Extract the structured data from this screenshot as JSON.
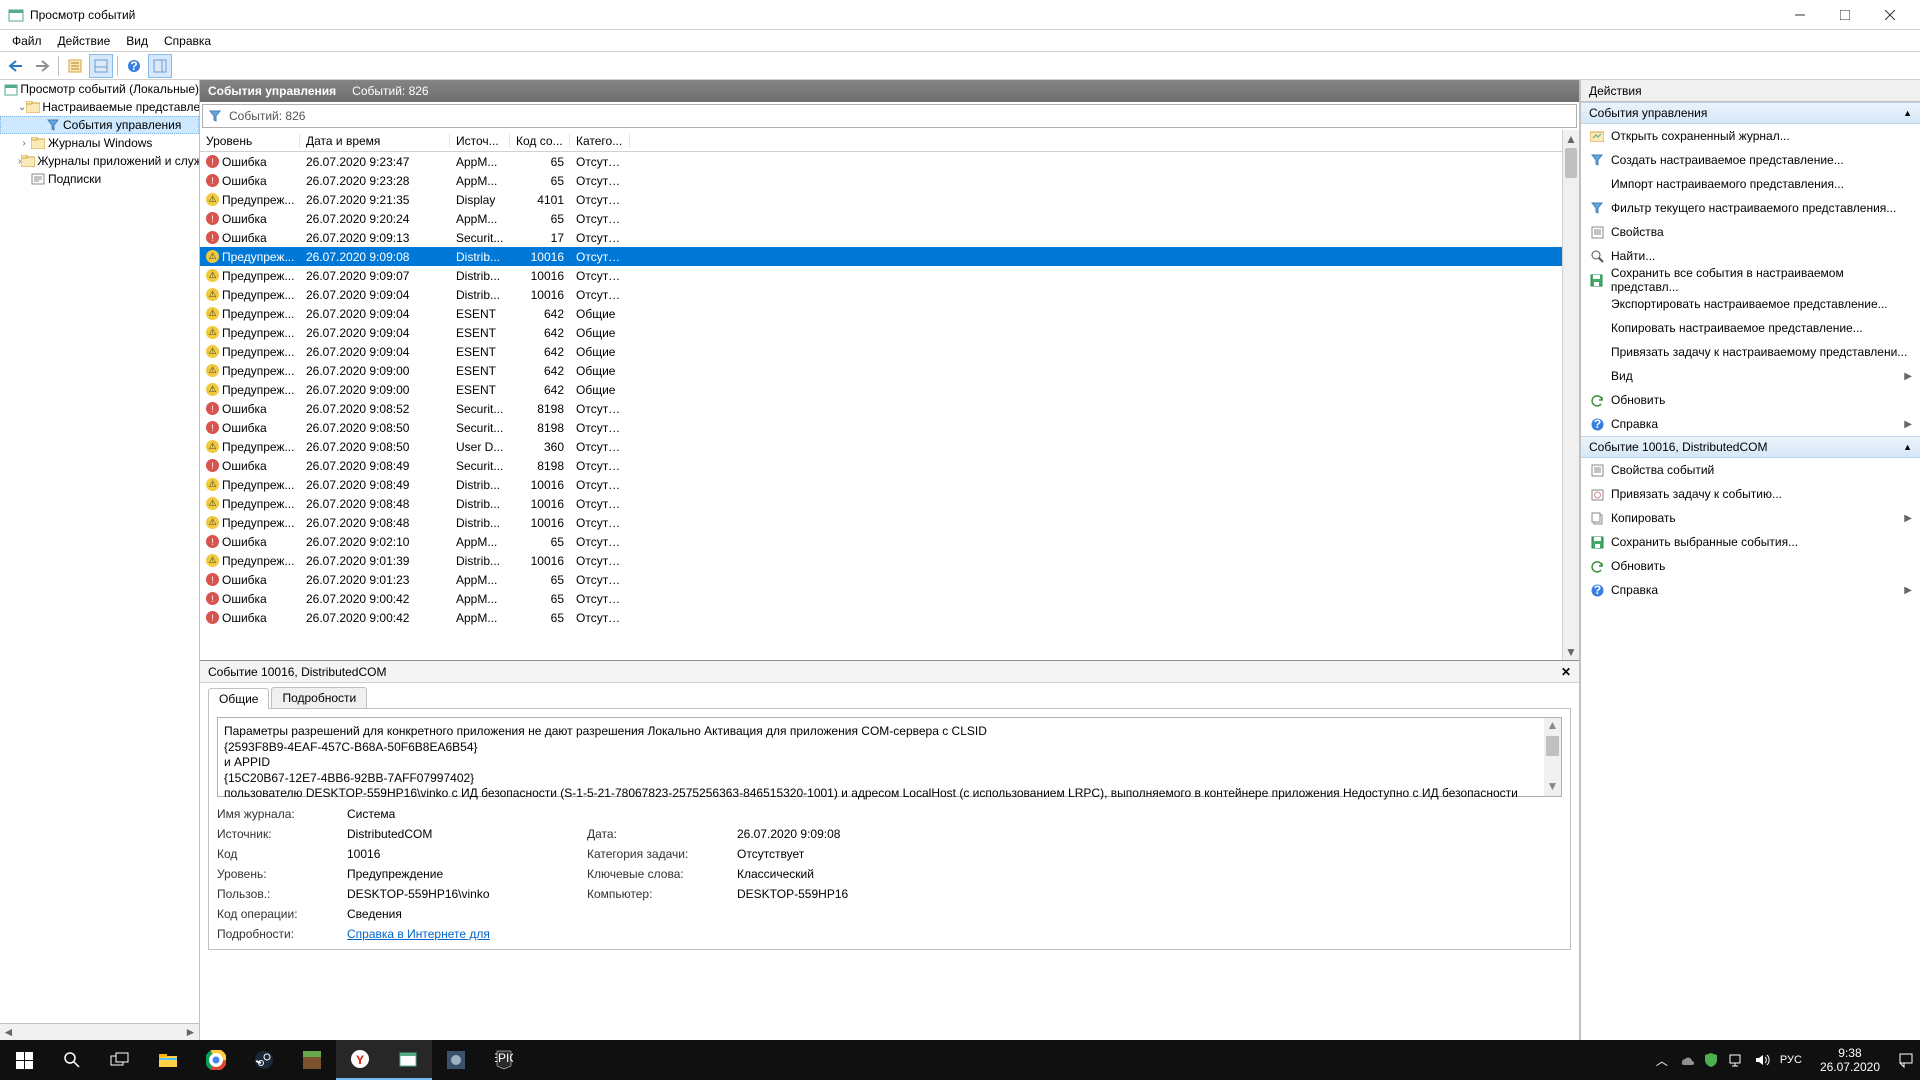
{
  "window": {
    "title": "Просмотр событий"
  },
  "menu": [
    "Файл",
    "Действие",
    "Вид",
    "Справка"
  ],
  "tree": {
    "root": "Просмотр событий (Локальные)",
    "items": [
      {
        "label": "Настраиваемые представления",
        "indent": 1,
        "twist": "v",
        "icon": "folder"
      },
      {
        "label": "События управления",
        "indent": 2,
        "twist": "",
        "icon": "filter",
        "selected": true
      },
      {
        "label": "Журналы Windows",
        "indent": 1,
        "twist": ">",
        "icon": "folder"
      },
      {
        "label": "Журналы приложений и служб",
        "indent": 1,
        "twist": ">",
        "icon": "folder"
      },
      {
        "label": "Подписки",
        "indent": 1,
        "twist": "",
        "icon": "sub"
      }
    ]
  },
  "center": {
    "title": "События управления",
    "count_label": "Событий: 826",
    "filter_label": "Событий: 826"
  },
  "cols": {
    "level": "Уровень",
    "datetime": "Дата и время",
    "source": "Источ...",
    "eventid": "Код со...",
    "category": "Катего..."
  },
  "rows": [
    {
      "lv": "err",
      "lvl": "Ошибка",
      "dt": "26.07.2020 9:23:47",
      "src": "AppM...",
      "id": "65",
      "cat": "Отсутс..."
    },
    {
      "lv": "err",
      "lvl": "Ошибка",
      "dt": "26.07.2020 9:23:28",
      "src": "AppM...",
      "id": "65",
      "cat": "Отсутс..."
    },
    {
      "lv": "warn",
      "lvl": "Предупреж...",
      "dt": "26.07.2020 9:21:35",
      "src": "Display",
      "id": "4101",
      "cat": "Отсутс..."
    },
    {
      "lv": "err",
      "lvl": "Ошибка",
      "dt": "26.07.2020 9:20:24",
      "src": "AppM...",
      "id": "65",
      "cat": "Отсутс..."
    },
    {
      "lv": "err",
      "lvl": "Ошибка",
      "dt": "26.07.2020 9:09:13",
      "src": "Securit...",
      "id": "17",
      "cat": "Отсутс..."
    },
    {
      "lv": "warn",
      "lvl": "Предупреж...",
      "dt": "26.07.2020 9:09:08",
      "src": "Distrib...",
      "id": "10016",
      "cat": "Отсутс...",
      "sel": true
    },
    {
      "lv": "warn",
      "lvl": "Предупреж...",
      "dt": "26.07.2020 9:09:07",
      "src": "Distrib...",
      "id": "10016",
      "cat": "Отсутс..."
    },
    {
      "lv": "warn",
      "lvl": "Предупреж...",
      "dt": "26.07.2020 9:09:04",
      "src": "Distrib...",
      "id": "10016",
      "cat": "Отсутс..."
    },
    {
      "lv": "warn",
      "lvl": "Предупреж...",
      "dt": "26.07.2020 9:09:04",
      "src": "ESENT",
      "id": "642",
      "cat": "Общие"
    },
    {
      "lv": "warn",
      "lvl": "Предупреж...",
      "dt": "26.07.2020 9:09:04",
      "src": "ESENT",
      "id": "642",
      "cat": "Общие"
    },
    {
      "lv": "warn",
      "lvl": "Предупреж...",
      "dt": "26.07.2020 9:09:04",
      "src": "ESENT",
      "id": "642",
      "cat": "Общие"
    },
    {
      "lv": "warn",
      "lvl": "Предупреж...",
      "dt": "26.07.2020 9:09:00",
      "src": "ESENT",
      "id": "642",
      "cat": "Общие"
    },
    {
      "lv": "warn",
      "lvl": "Предупреж...",
      "dt": "26.07.2020 9:09:00",
      "src": "ESENT",
      "id": "642",
      "cat": "Общие"
    },
    {
      "lv": "err",
      "lvl": "Ошибка",
      "dt": "26.07.2020 9:08:52",
      "src": "Securit...",
      "id": "8198",
      "cat": "Отсутс..."
    },
    {
      "lv": "err",
      "lvl": "Ошибка",
      "dt": "26.07.2020 9:08:50",
      "src": "Securit...",
      "id": "8198",
      "cat": "Отсутс..."
    },
    {
      "lv": "warn",
      "lvl": "Предупреж...",
      "dt": "26.07.2020 9:08:50",
      "src": "User D...",
      "id": "360",
      "cat": "Отсутс..."
    },
    {
      "lv": "err",
      "lvl": "Ошибка",
      "dt": "26.07.2020 9:08:49",
      "src": "Securit...",
      "id": "8198",
      "cat": "Отсутс..."
    },
    {
      "lv": "warn",
      "lvl": "Предупреж...",
      "dt": "26.07.2020 9:08:49",
      "src": "Distrib...",
      "id": "10016",
      "cat": "Отсутс..."
    },
    {
      "lv": "warn",
      "lvl": "Предупреж...",
      "dt": "26.07.2020 9:08:48",
      "src": "Distrib...",
      "id": "10016",
      "cat": "Отсутс..."
    },
    {
      "lv": "warn",
      "lvl": "Предупреж...",
      "dt": "26.07.2020 9:08:48",
      "src": "Distrib...",
      "id": "10016",
      "cat": "Отсутс..."
    },
    {
      "lv": "err",
      "lvl": "Ошибка",
      "dt": "26.07.2020 9:02:10",
      "src": "AppM...",
      "id": "65",
      "cat": "Отсутс..."
    },
    {
      "lv": "warn",
      "lvl": "Предупреж...",
      "dt": "26.07.2020 9:01:39",
      "src": "Distrib...",
      "id": "10016",
      "cat": "Отсутс..."
    },
    {
      "lv": "err",
      "lvl": "Ошибка",
      "dt": "26.07.2020 9:01:23",
      "src": "AppM...",
      "id": "65",
      "cat": "Отсутс..."
    },
    {
      "lv": "err",
      "lvl": "Ошибка",
      "dt": "26.07.2020 9:00:42",
      "src": "AppM...",
      "id": "65",
      "cat": "Отсутс..."
    },
    {
      "lv": "err",
      "lvl": "Ошибка",
      "dt": "26.07.2020 9:00:42",
      "src": "AppM...",
      "id": "65",
      "cat": "Отсутс..."
    }
  ],
  "detail": {
    "title": "Событие 10016, DistributedCOM",
    "tabs": [
      "Общие",
      "Подробности"
    ],
    "msg": [
      "Параметры разрешений для конкретного приложения не дают разрешения Локально Активация для приложения COM-сервера с CLSID",
      "{2593F8B9-4EAF-457C-B68A-50F6B8EA6B54}",
      " и APPID",
      "{15C20B67-12E7-4BB6-92BB-7AFF07997402}",
      " пользователю DESKTOP-559HP16\\vinko с ИД безопасности (S-1-5-21-78067823-2575256363-846515320-1001) и адресом LocalHost (с использованием LRPC), выполняемого в контейнере приложения Недоступно с ИД безопасности"
    ],
    "props": {
      "log_l": "Имя журнала:",
      "log_v": "Система",
      "src_l": "Источник:",
      "src_v": "DistributedCOM",
      "date_l": "Дата:",
      "date_v": "26.07.2020 9:09:08",
      "id_l": "Код",
      "id_v": "10016",
      "cat_l": "Категория задачи:",
      "cat_v": "Отсутствует",
      "lvl_l": "Уровень:",
      "lvl_v": "Предупреждение",
      "kw_l": "Ключевые слова:",
      "kw_v": "Классический",
      "usr_l": "Пользов.:",
      "usr_v": "DESKTOP-559HP16\\vinko",
      "comp_l": "Компьютер:",
      "comp_v": "DESKTOP-559HP16",
      "op_l": "Код операции:",
      "op_v": "Сведения",
      "more_l": "Подробности:",
      "more_v": "Справка в Интернете для "
    }
  },
  "actions": {
    "title": "Действия",
    "sec1": "События управления",
    "sec2": "Событие 10016, DistributedCOM",
    "items1": [
      {
        "icon": "open",
        "label": "Открыть сохраненный журнал..."
      },
      {
        "icon": "filter",
        "label": "Создать настраиваемое представление..."
      },
      {
        "icon": "",
        "label": "Импорт настраиваемого представления..."
      },
      {
        "icon": "filter",
        "label": "Фильтр текущего настраиваемого представления..."
      },
      {
        "icon": "props",
        "label": "Свойства"
      },
      {
        "icon": "find",
        "label": "Найти..."
      },
      {
        "icon": "save",
        "label": "Сохранить все события в настраиваемом представл..."
      },
      {
        "icon": "",
        "label": "Экспортировать настраиваемое представление..."
      },
      {
        "icon": "",
        "label": "Копировать настраиваемое представление..."
      },
      {
        "icon": "",
        "label": "Привязать задачу к настраиваемому представлени..."
      },
      {
        "icon": "",
        "label": "Вид",
        "sub": true
      },
      {
        "icon": "refresh",
        "label": "Обновить"
      },
      {
        "icon": "help",
        "label": "Справка",
        "sub": true
      }
    ],
    "items2": [
      {
        "icon": "props",
        "label": "Свойства событий"
      },
      {
        "icon": "task",
        "label": "Привязать задачу к событию..."
      },
      {
        "icon": "copy",
        "label": "Копировать",
        "sub": true
      },
      {
        "icon": "save",
        "label": "Сохранить выбранные события..."
      },
      {
        "icon": "refresh",
        "label": "Обновить"
      },
      {
        "icon": "help",
        "label": "Справка",
        "sub": true
      }
    ]
  },
  "taskbar": {
    "lang": "РУС",
    "time": "9:38",
    "date": "26.07.2020"
  }
}
